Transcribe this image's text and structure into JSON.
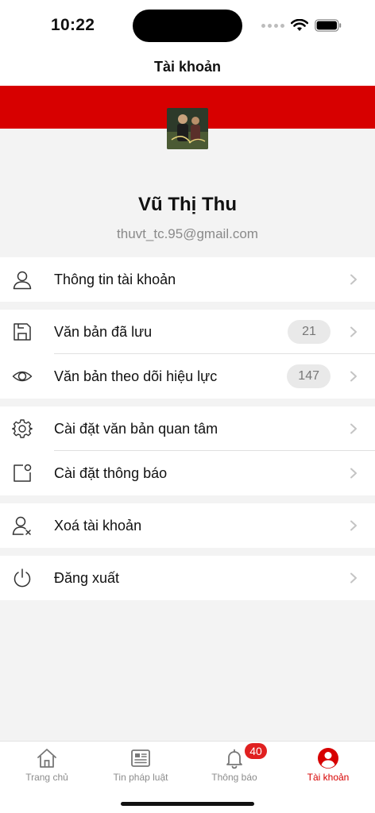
{
  "status": {
    "time": "10:22"
  },
  "header": {
    "title": "Tài khoản"
  },
  "profile": {
    "name": "Vũ Thị Thu",
    "email": "thuvt_tc.95@gmail.com"
  },
  "menu": {
    "account_info": {
      "label": "Thông tin tài khoản",
      "icon": "user-icon"
    },
    "saved_docs": {
      "label": "Văn bản đã lưu",
      "count": "21",
      "icon": "save-icon"
    },
    "tracked_docs": {
      "label": "Văn bản theo dõi hiệu lực",
      "count": "147",
      "icon": "eye-icon"
    },
    "interest_settings": {
      "label": "Cài đặt văn bản quan tâm",
      "icon": "gear-icon"
    },
    "notification_settings": {
      "label": "Cài đặt thông báo",
      "icon": "notification-settings-icon"
    },
    "delete_account": {
      "label": "Xoá tài khoản",
      "icon": "user-remove-icon"
    },
    "logout": {
      "label": "Đăng xuất",
      "icon": "power-icon"
    }
  },
  "tabs": [
    {
      "label": "Trang chủ",
      "icon": "home-icon"
    },
    {
      "label": "Tin pháp luật",
      "icon": "newspaper-icon"
    },
    {
      "label": "Thông báo",
      "icon": "bell-icon",
      "badge": "40"
    },
    {
      "label": "Tài khoản",
      "icon": "account-icon",
      "active": true
    }
  ],
  "colors": {
    "accent": "#d70000",
    "badge": "#e02020",
    "background": "#f3f3f3"
  }
}
